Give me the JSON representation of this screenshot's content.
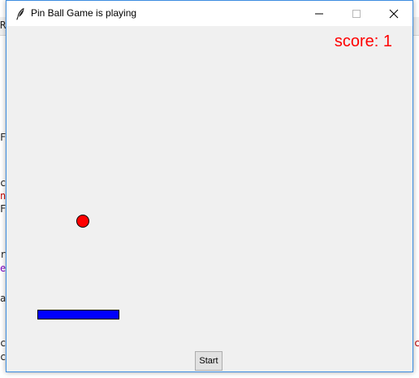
{
  "background": {
    "fragments": [
      "R",
      "Fi",
      "cu",
      "n",
      "Fi",
      "r n",
      "e=",
      "av",
      "c",
      "ce",
      "c"
    ]
  },
  "window": {
    "title": "Pin Ball Game is playing",
    "controls": {
      "minimize": "minimize-icon",
      "maximize": "maximize-icon",
      "close": "close-icon"
    }
  },
  "game": {
    "score_text": "score: 1",
    "start_label": "Start",
    "colors": {
      "score": "#ff0000",
      "ball": "#ff0000",
      "paddle": "#0000ff",
      "canvas": "#f0f0f0"
    }
  }
}
